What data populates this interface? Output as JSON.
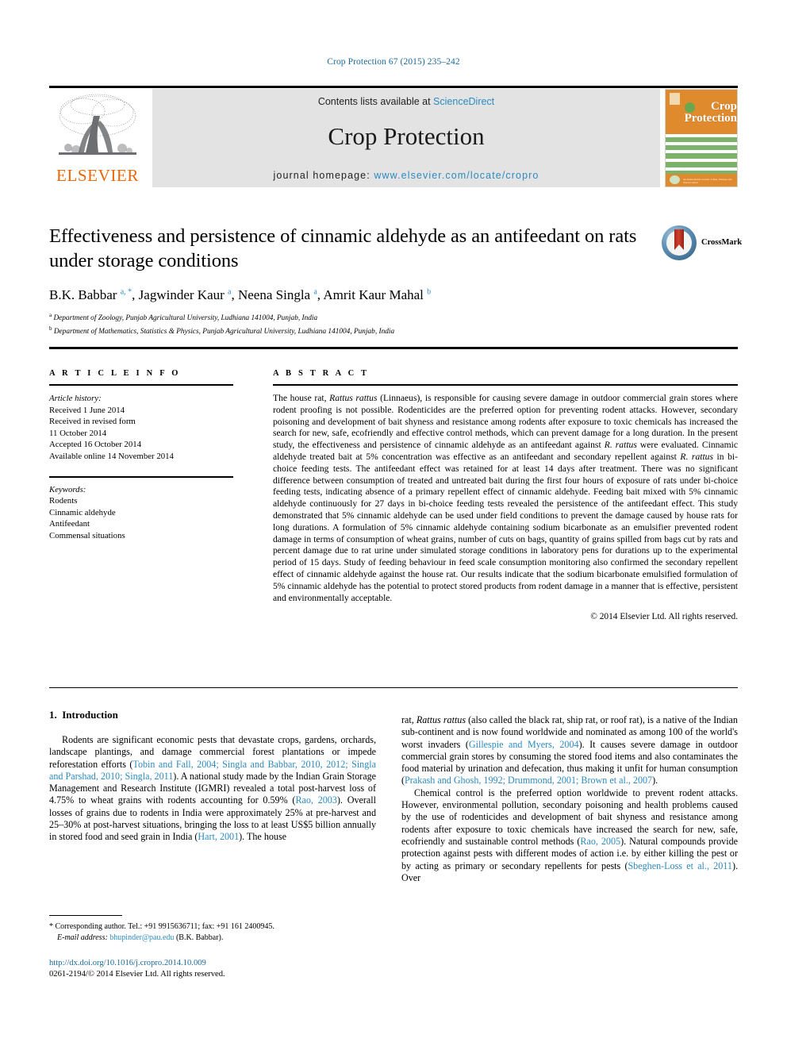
{
  "running_head": "Crop Protection 67 (2015) 235–242",
  "masthead": {
    "publisher_name": "ELSEVIER",
    "contents_prefix": "Contents lists available at ",
    "contents_link": "ScienceDirect",
    "journal_title": "Crop Protection",
    "homepage_prefix": "journal homepage: ",
    "homepage_url": "www.elsevier.com/locate/cropro",
    "cover": {
      "title_line1": "Crop",
      "title_line2": "Protection",
      "footer_note": "An International Journal of Pest, Disease and Weed Control"
    }
  },
  "article": {
    "title": "Effectiveness and persistence of cinnamic aldehyde as an antifeedant on rats under storage conditions",
    "crossmark_label": "CrossMark",
    "authors_html": "B.K. Babbar <sup>a, *</sup>, Jagwinder Kaur <sup>a</sup>, Neena Singla <sup>a</sup>, Amrit Kaur Mahal <sup>b</sup>",
    "affiliation_a": "Department of Zoology, Punjab Agricultural University, Ludhiana 141004, Punjab, India",
    "affiliation_b": "Department of Mathematics, Statistics & Physics, Punjab Agricultural University, Ludhiana 141004, Punjab, India"
  },
  "article_info": {
    "heading": "A R T I C L E   I N F O",
    "history_label": "Article history:",
    "history": [
      "Received 1 June 2014",
      "Received in revised form",
      "11 October 2014",
      "Accepted 16 October 2014",
      "Available online 14 November 2014"
    ],
    "keywords_label": "Keywords:",
    "keywords": [
      "Rodents",
      "Cinnamic aldehyde",
      "Antifeedant",
      "Commensal situations"
    ]
  },
  "abstract": {
    "heading": "A B S T R A C T",
    "text_html": "The house rat, <i>Rattus rattus</i> (Linnaeus), is responsible for causing severe damage in outdoor commercial grain stores where rodent proofing is not possible. Rodenticides are the preferred option for preventing rodent attacks. However, secondary poisoning and development of bait shyness and resistance among rodents after exposure to toxic chemicals has increased the search for new, safe, ecofriendly and effective control methods, which can prevent damage for a long duration. In the present study, the effectiveness and persistence of cinnamic aldehyde as an antifeedant against <i>R. rattus</i> were evaluated. Cinnamic aldehyde treated bait at 5% concentration was effective as an antifeedant and secondary repellent against <i>R. rattus</i> in bi-choice feeding tests. The antifeedant effect was retained for at least 14 days after treatment. There was no significant difference between consumption of treated and untreated bait during the first four hours of exposure of rats under bi-choice feeding tests, indicating absence of a primary repellent effect of cinnamic aldehyde. Feeding bait mixed with 5% cinnamic aldehyde continuously for 27 days in bi-choice feeding tests revealed the persistence of the antifeedant effect. This study demonstrated that 5% cinnamic aldehyde can be used under field conditions to prevent the damage caused by house rats for long durations. A formulation of 5% cinnamic aldehyde containing sodium bicarbonate as an emulsifier prevented rodent damage in terms of consumption of wheat grains, number of cuts on bags, quantity of grains spilled from bags cut by rats and percent damage due to rat urine under simulated storage conditions in laboratory pens for durations up to the experimental period of 15 days. Study of feeding behaviour in feed scale consumption monitoring also confirmed the secondary repellent effect of cinnamic aldehyde against the house rat. Our results indicate that the sodium bicarbonate emulsified formulation of 5% cinnamic aldehyde has the potential to protect stored products from rodent damage in a manner that is effective, persistent and environmentally acceptable.",
    "copyright": "© 2014 Elsevier Ltd. All rights reserved."
  },
  "body": {
    "section_number": "1.",
    "section_title": "Introduction",
    "left_para_1_html": "Rodents are significant economic pests that devastate crops, gardens, orchards, landscape plantings, and damage commercial forest plantations or impede reforestation efforts (<span class=\"cite\">Tobin and Fall, 2004; Singla and Babbar, 2010, 2012; Singla and Parshad, 2010; Singla, 2011</span>). A national study made by the Indian Grain Storage Management and Research Institute (IGMRI) revealed a total post-harvest loss of 4.75% to wheat grains with rodents accounting for 0.59% (<span class=\"cite\">Rao, 2003</span>). Overall losses of grains due to rodents in India were approximately 25% at pre-harvest and 25–30% at post-harvest situations, bringing the loss to at least US$5 billion annually in stored food and seed grain in India (<span class=\"cite\">Hart, 2001</span>). The house",
    "right_para_1_html": "rat, <i>Rattus rattus</i> (also called the black rat, ship rat, or roof rat), is a native of the Indian sub-continent and is now found worldwide and nominated as among 100 of the world's worst invaders (<span class=\"cite\">Gillespie and Myers, 2004</span>). It causes severe damage in outdoor commercial grain stores by consuming the stored food items and also contaminates the food material by urination and defecation, thus making it unfit for human consumption (<span class=\"cite\">Prakash and Ghosh, 1992; Drummond, 2001; Brown et al., 2007</span>).",
    "right_para_2_html": "Chemical control is the preferred option worldwide to prevent rodent attacks. However, environmental pollution, secondary poisoning and health problems caused by the use of rodenticides and development of bait shyness and resistance among rodents after exposure to toxic chemicals have increased the search for new, safe, ecofriendly and sustainable control methods (<span class=\"cite\">Rao, 2005</span>). Natural compounds provide protection against pests with different modes of action i.e. by either killing the pest or by acting as primary or secondary repellents for pests (<span class=\"cite\">Sbeghen-Loss et al., 2011</span>). Over"
  },
  "footnote": {
    "corresponding_html": "* Corresponding author. Tel.: +91 9915636711; fax: +91 161 2400945.",
    "email_label": "E-mail address:",
    "email": "bhupinder@pau.edu",
    "email_suffix": "(B.K. Babbar)."
  },
  "footer": {
    "doi": "http://dx.doi.org/10.1016/j.cropro.2014.10.009",
    "issn_line": "0261-2194/© 2014 Elsevier Ltd. All rights reserved."
  }
}
